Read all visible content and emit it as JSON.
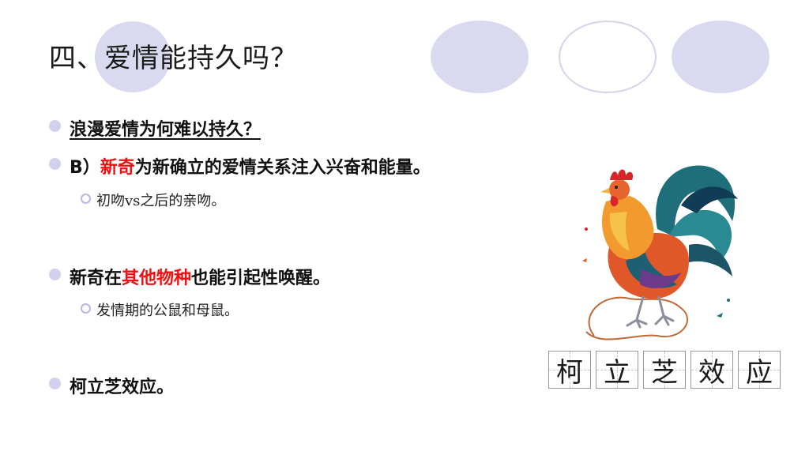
{
  "slide": {
    "title": "四、爱情能持久吗？",
    "bullets": [
      {
        "text": "浪漫爱情为何难以持久？"
      },
      {
        "prefix": "B）",
        "highlight": "新奇",
        "rest": "为新确立的爱情关系注入兴奋和能量。"
      },
      {
        "sub": "初吻vs之后的亲吻。"
      },
      {
        "prefix": "新奇在",
        "highlight": "其他物种",
        "rest": "也能引起性唤醒。"
      },
      {
        "sub": "发情期的公鼠和母鼠。"
      },
      {
        "text": "柯立芝效应。"
      }
    ],
    "caption_chars": [
      "柯",
      "立",
      "芝",
      "效",
      "应"
    ]
  },
  "colors": {
    "accent_red": "#ee1111",
    "bullet": "#d1d1ee",
    "circle": "#d9d9ef"
  },
  "image": {
    "icon": "rooster-illustration"
  }
}
